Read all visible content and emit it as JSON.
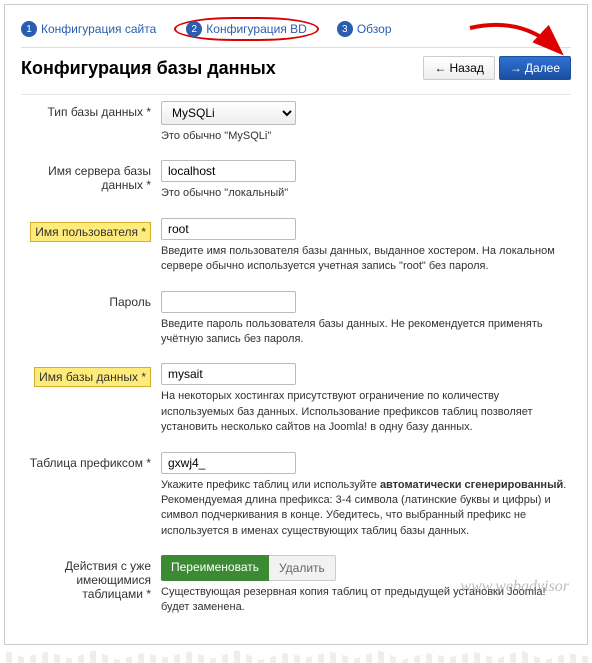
{
  "steps": [
    {
      "num": "1",
      "label": "Конфигурация сайта"
    },
    {
      "num": "2",
      "label": "Конфигурация BD"
    },
    {
      "num": "3",
      "label": "Обзор"
    }
  ],
  "title": "Конфигурация базы данных",
  "buttons": {
    "back": "Назад",
    "next": "Далее"
  },
  "fields": {
    "dbtype": {
      "label": "Тип базы данных *",
      "value": "MySQLi",
      "help": "Это обычно \"MySQLi\""
    },
    "host": {
      "label": "Имя сервера базы данных *",
      "value": "localhost",
      "help": "Это обычно \"локальный\""
    },
    "user": {
      "label": "Имя пользователя *",
      "value": "root",
      "help": "Введите имя пользователя базы данных, выданное хостером. На локальном сервере обычно используется учетная запись \"root\" без пароля."
    },
    "pass": {
      "label": "Пароль",
      "value": "",
      "help": "Введите пароль пользователя базы данных. Не рекомендуется применять учётную запись без пароля."
    },
    "dbname": {
      "label": "Имя базы данных *",
      "value": "mysait",
      "help": "На некоторых хостингах присутствуют ограничение по количеству используемых баз данных. Использование префиксов таблиц позволяет установить несколько сайтов на Joomla! в одну базу данных."
    },
    "prefix": {
      "label": "Таблица префиксом *",
      "value": "gxwj4_",
      "help": "Укажите префикс таблиц или используйте автоматически сгенерированный. Рекомендуемая длина префикса: 3-4 символа (латинские буквы и цифры) и символ подчеркивания в конце. Убедитесь, что выбранный префикс не используется в именах существующих таблиц базы данных.",
      "help_bold": "автоматически сгенерированный"
    },
    "old": {
      "label": "Действия с уже имеющимися таблицами *",
      "on": "Переименовать",
      "off": "Удалить",
      "help": "Существующая резервная копия таблиц от предыдущей установки Joomla! будет заменена."
    }
  },
  "watermark": "www.webadvisor"
}
